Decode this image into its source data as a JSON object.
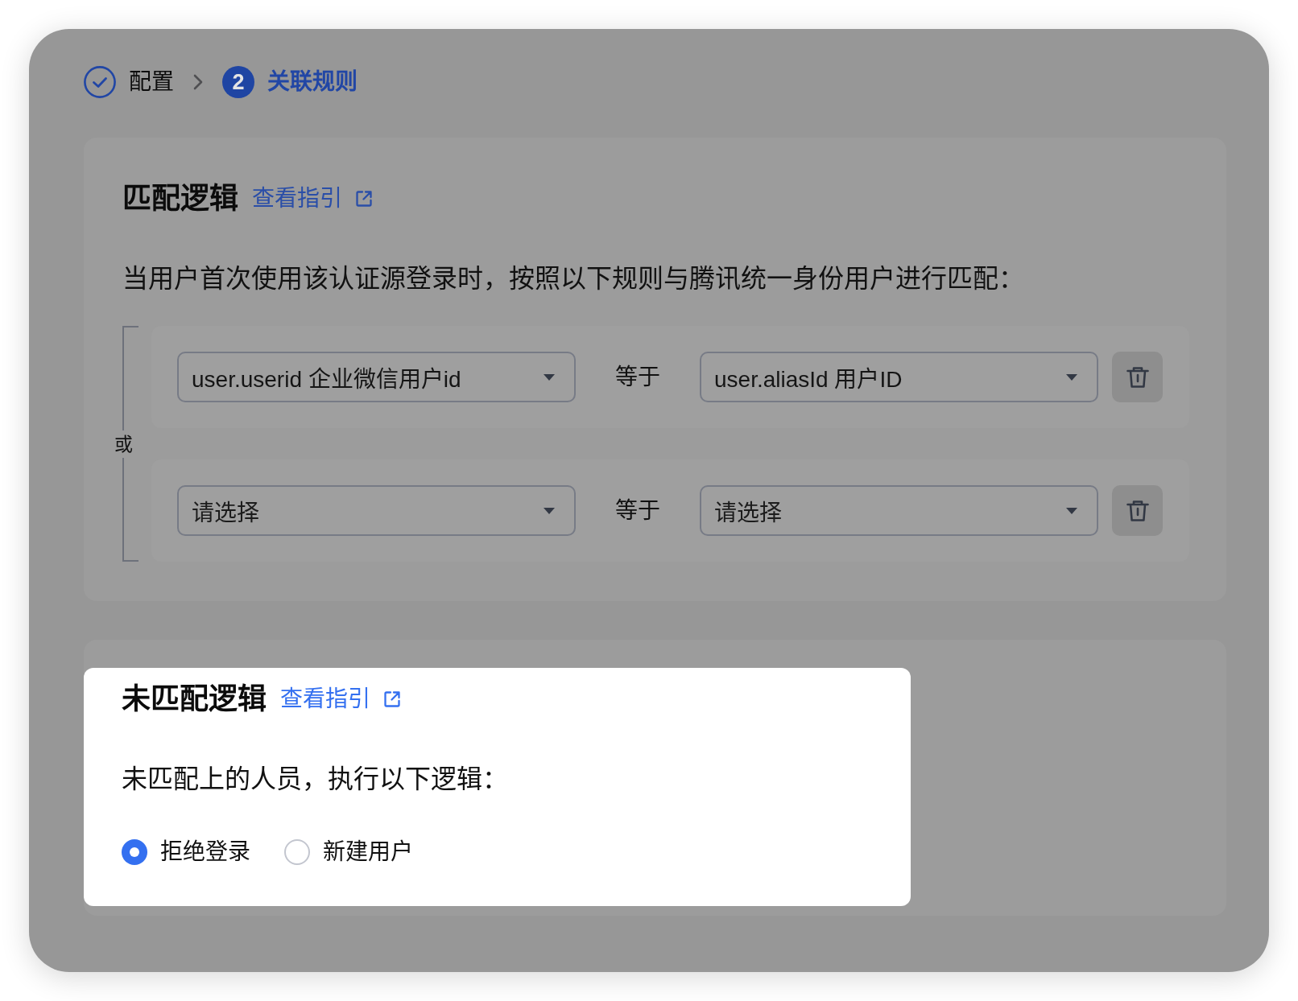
{
  "steps": [
    {
      "label": "配置",
      "done": true,
      "selected": false
    },
    {
      "number": "2",
      "label": "关联规则",
      "done": false,
      "selected": true
    }
  ],
  "match_logic": {
    "highlighted": false,
    "title": "匹配逻辑",
    "guide_link": "查看指引",
    "description": "当用户首次使用该认证源登录时，按照以下规则与腾讯统一身份用户进行匹配：",
    "connector": "或",
    "rules": [
      {
        "left": {
          "value": "user.userid 企业微信用户id"
        },
        "operator": "等于",
        "right": {
          "value": "user.aliasId 用户ID"
        }
      },
      {
        "left": {
          "placeholder": "请选择"
        },
        "operator": "等于",
        "right": {
          "placeholder": "请选择"
        }
      }
    ]
  },
  "unmatched_logic": {
    "highlighted": true,
    "title": "未匹配逻辑",
    "guide_link": "查看指引",
    "description": "未匹配上的人员，执行以下逻辑：",
    "options": [
      {
        "label": "拒绝登录",
        "selected": true
      },
      {
        "label": "新建用户",
        "selected": false
      }
    ]
  }
}
